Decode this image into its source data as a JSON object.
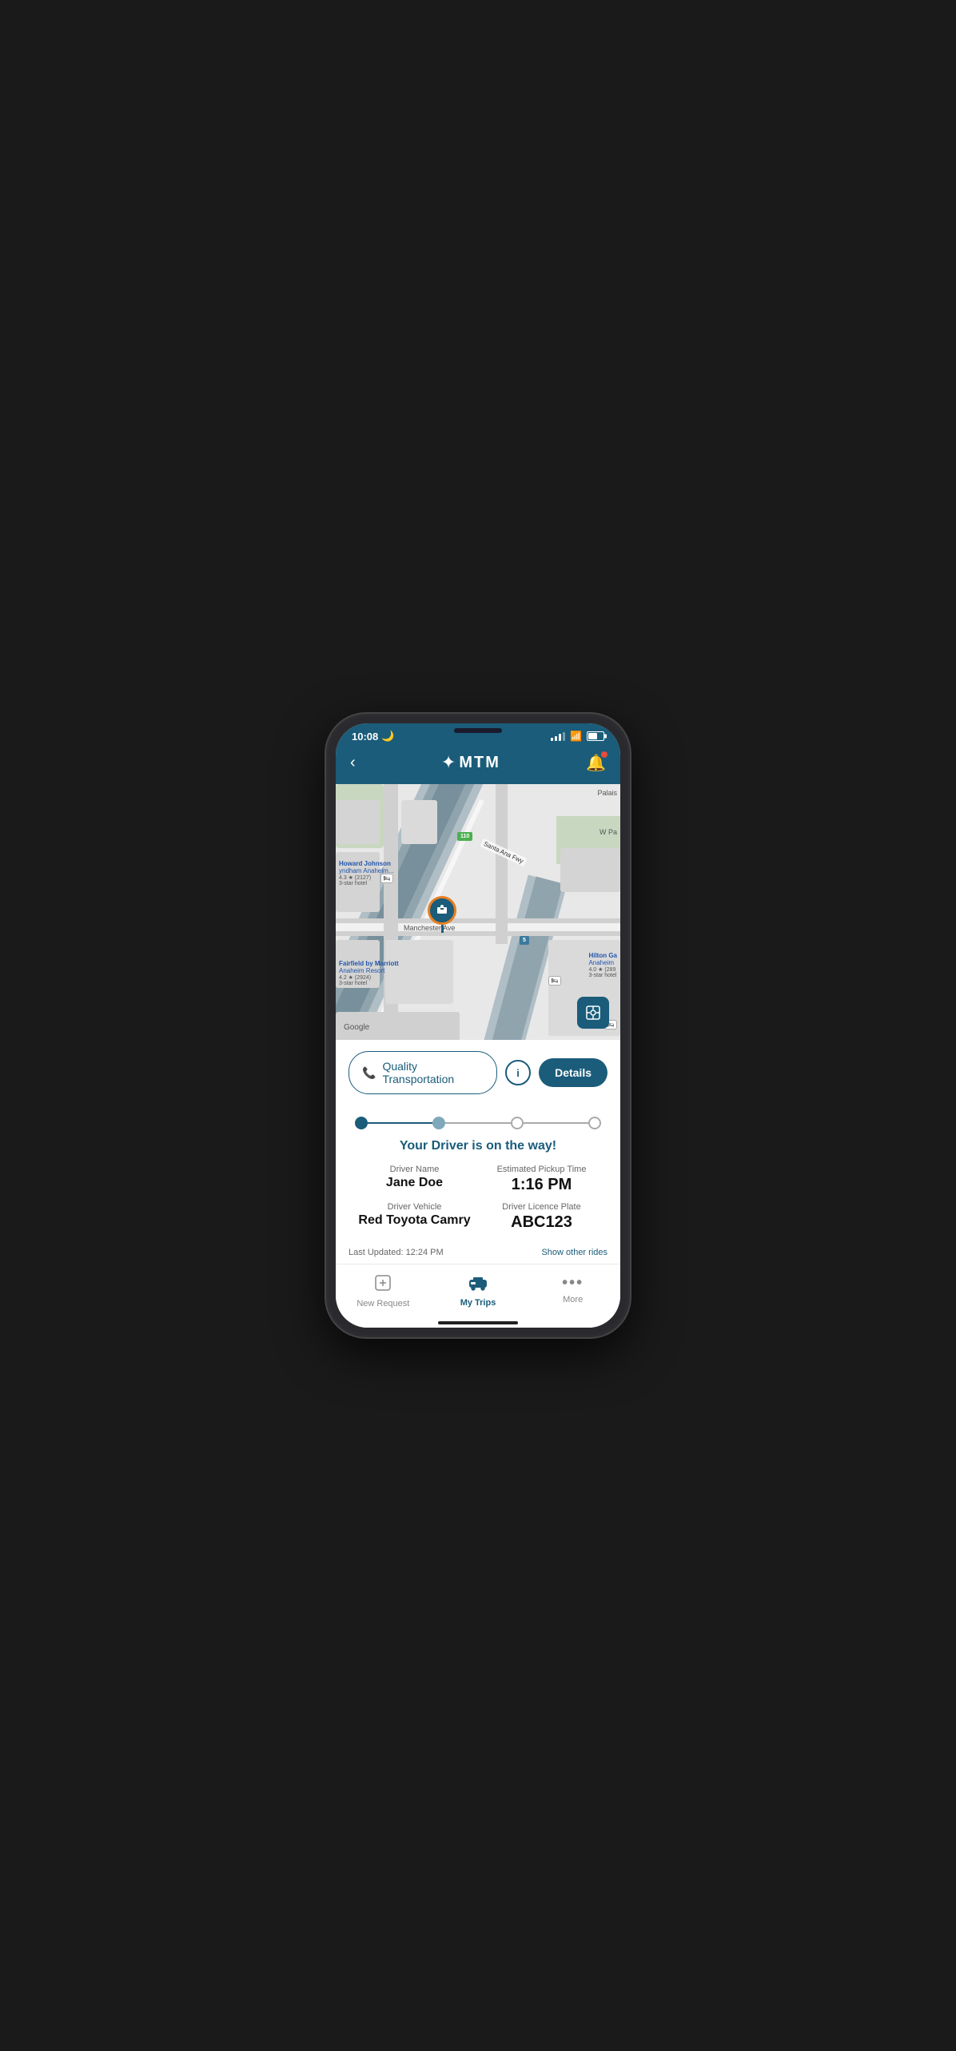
{
  "status_bar": {
    "time": "10:08",
    "moon_icon": "🌙"
  },
  "header": {
    "back_label": "‹",
    "logo_text": "MTM",
    "logo_icon": "✦",
    "notification_icon": "🔔"
  },
  "map": {
    "google_label": "Google",
    "recenter_icon": "⊡",
    "labels": {
      "manchester_ave": "Manchester Ave",
      "santa_ana_fwy": "Santa Ana Fwy",
      "w_pa": "W Pa",
      "palais": "Palais",
      "hilton": "Hilton Ga",
      "anaheim": "Anaheim",
      "hilton_rating": "4.0 ★ (289",
      "hilton_type": "3-star hotel",
      "fairfield": "Fairfield by Marriott",
      "fairfield2": "Anaheim Resort",
      "fairfield_rating": "4.2 ★ (2924)",
      "fairfield_type": "3-star hotel",
      "howard": "Howard Johnson",
      "wyndham": "yndham Anaheim...",
      "howard_rating": "4.3 ★ (2127)",
      "howard_type": "3-star hotel",
      "hwy_110": "110",
      "hwy_5": "5"
    }
  },
  "action_bar": {
    "call_label": "Quality Transportation",
    "call_icon": "📞",
    "info_label": "i",
    "details_label": "Details"
  },
  "progress": {
    "dots": [
      "active",
      "semi",
      "inactive",
      "inactive"
    ],
    "lines": [
      "active",
      "inactive",
      "inactive"
    ]
  },
  "driver_status": {
    "message": "Your Driver is on the way!"
  },
  "driver_info": {
    "name_label": "Driver Name",
    "name_value": "Jane Doe",
    "pickup_label": "Estimated Pickup Time",
    "pickup_value": "1:16 PM",
    "vehicle_label": "Driver Vehicle",
    "vehicle_value": "Red Toyota Camry",
    "plate_label": "Driver Licence Plate",
    "plate_value": "ABC123"
  },
  "footer": {
    "last_updated_label": "Last Updated:",
    "last_updated_time": "12:24 PM",
    "show_other_rides": "Show other rides"
  },
  "nav": {
    "items": [
      {
        "icon": "➕",
        "label": "New Request",
        "active": false,
        "icon_type": "box-plus"
      },
      {
        "icon": "🚗",
        "label": "My Trips",
        "active": true,
        "icon_type": "car"
      },
      {
        "icon": "•••",
        "label": "More",
        "active": false,
        "icon_type": "more"
      }
    ]
  }
}
